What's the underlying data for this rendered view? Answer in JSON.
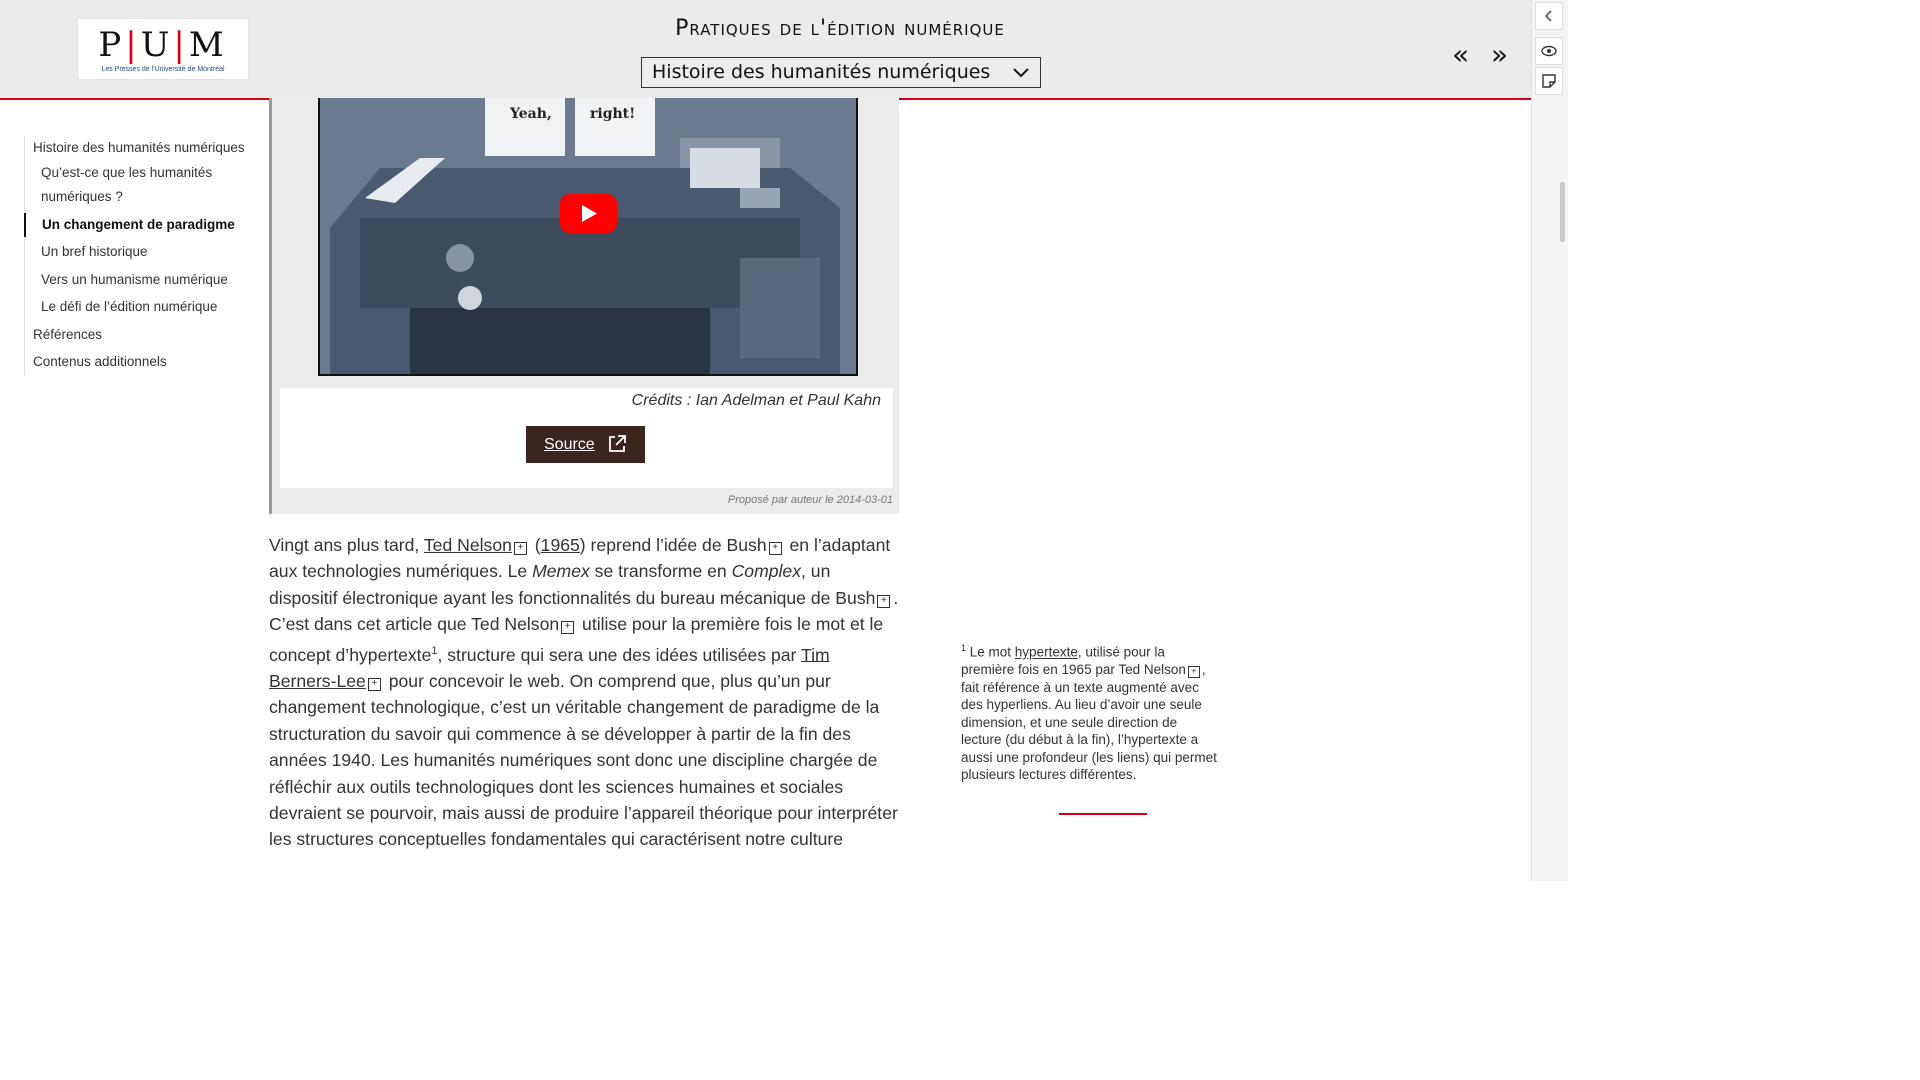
{
  "header": {
    "logo_letters": [
      "P",
      "U",
      "M"
    ],
    "logo_subtitle": "Les Presses de l'Université de Montréal",
    "book_title": "Pratiques de l'édition numérique",
    "chapter_select": "Histoire des humanités numériques",
    "prev_glyph": "«",
    "next_glyph": "»"
  },
  "rail": {
    "collapse_icon": "chevron-left-icon",
    "eye_icon": "eye-icon",
    "note_icon": "sticky-note-icon"
  },
  "toc": {
    "items": [
      {
        "label": "Histoire des humanités numériques",
        "level": 1,
        "active": false
      },
      {
        "label": "Qu’est-ce que les humanités numériques ?",
        "level": 2,
        "active": false
      },
      {
        "label": "Un changement de paradigme",
        "level": 2,
        "active": true
      },
      {
        "label": "Un bref historique",
        "level": 2,
        "active": false
      },
      {
        "label": "Vers un humanisme numérique",
        "level": 2,
        "active": false
      },
      {
        "label": "Le défi de l’édition numérique",
        "level": 2,
        "active": false
      },
      {
        "label": "Références",
        "level": 1,
        "active": false
      },
      {
        "label": "Contenus additionnels",
        "level": 1,
        "active": false
      }
    ]
  },
  "media": {
    "video_text_left": "Yeah,",
    "video_text_right": "right!",
    "play_icon": "youtube-play-icon",
    "credits": "Crédits : Ian Adelman et Paul Kahn",
    "source_label": "Source",
    "source_icon": "external-link-icon",
    "proposed": "Proposé par auteur le 2014-03-01"
  },
  "main": {
    "p1": "Vingt ans plus tard, ",
    "link_nelson": "Ted Nelson",
    "p2": " (",
    "link_1965": "1965",
    "p3": ") reprend l’idée de Bush",
    "p4": " en l’adaptant aux technologies numériques. Le ",
    "memex": "Memex",
    "p5": " se transforme en ",
    "complex": "Complex",
    "p6": ", un dispositif électronique ayant les fonctionnalités du bureau mécanique de Bush",
    "p7": ". C’est dans cet article que Ted Nelson",
    "p8": " utilise pour la première fois le mot et le concept d’hypertexte",
    "footnote_ref": "1",
    "p9": ", structure qui sera une des idées utilisées par ",
    "link_tbl": "Tim Berners-Lee",
    "p10": " pour concevoir le web. On comprend que, plus qu’un pur changement technologique, c’est un véritable changement de paradigme de la structuration du savoir qui commence à se développer à partir de la fin des années 1940. Les humanités numériques sont donc une discipline chargée de réfléchir aux outils technologiques dont les sciences humaines et sociales devraient se pourvoir, mais aussi de produire l’appareil théorique pour interpréter les structures conceptuelles fondamentales qui caractérisent notre culture",
    "expand_glyph": "+"
  },
  "note": {
    "num": "1",
    "t1": " Le mot ",
    "link": "hypertexte",
    "t2": ", utilisé pour la première fois en 1965 par Ted Nelson",
    "t3": ", fait référence à un texte augmenté avec des hyperliens. Au lieu d’avoir une seule dimension, et une seule direction de lecture (du début à la fin), l’hypertexte a aussi une profondeur (les liens) qui permet plusieurs lectures différentes."
  },
  "colors": {
    "accent": "#d0021b",
    "header_bg": "#ebebeb",
    "source_btn_bg": "#3b2520",
    "youtube_red": "#ff0000"
  }
}
